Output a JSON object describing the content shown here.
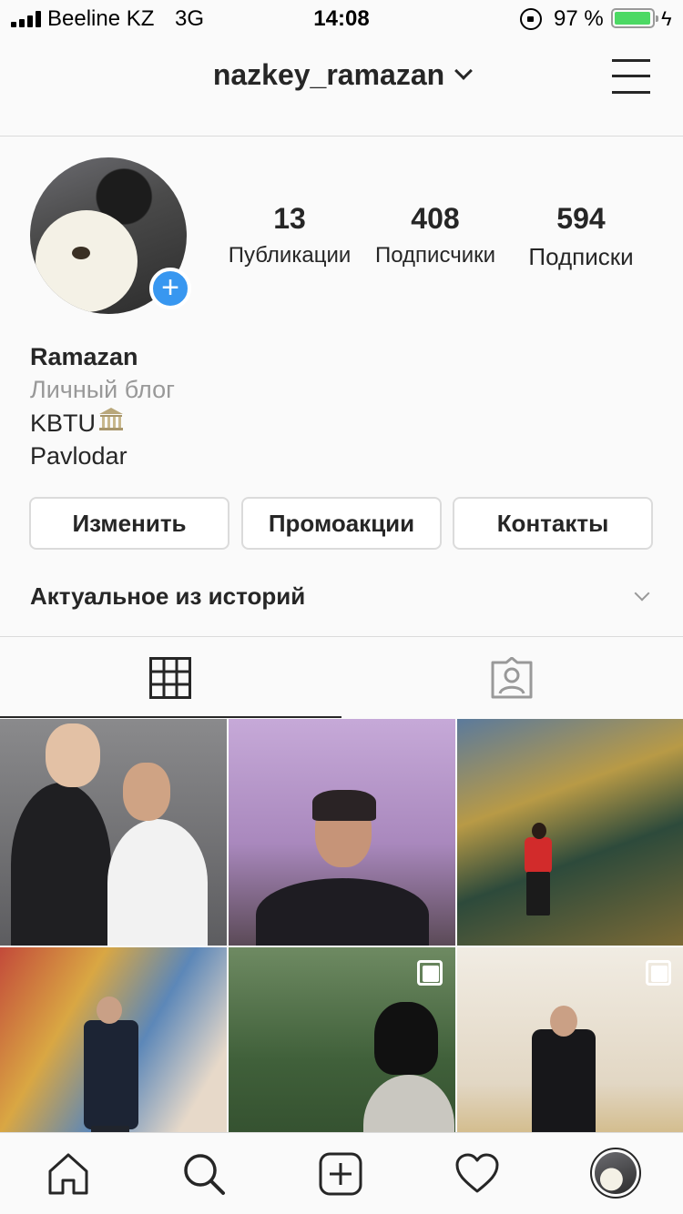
{
  "status_bar": {
    "carrier": "Beeline KZ",
    "network": "3G",
    "time": "14:08",
    "battery_percent": "97 %",
    "battery_level": 0.97
  },
  "header": {
    "username": "nazkey_ramazan"
  },
  "profile": {
    "stats": [
      {
        "value": "13",
        "label": "Публикации"
      },
      {
        "value": "408",
        "label": "Подписчики"
      },
      {
        "value": "594",
        "label": "Подписки"
      }
    ],
    "bio": {
      "name": "Ramazan",
      "category": "Личный блог",
      "line1": "KBTU",
      "line2": "Pavlodar"
    }
  },
  "buttons": {
    "edit": "Изменить",
    "promotions": "Промоакции",
    "contacts": "Контакты"
  },
  "highlights": {
    "title": "Актуальное из историй"
  },
  "tabs": {
    "active": "grid"
  },
  "colors": {
    "accent": "#3897f0",
    "battery": "#4cd964",
    "text": "#262626",
    "muted": "#999999",
    "border": "#dbdbdb"
  },
  "icons": {
    "bottom_bar": [
      "home-icon",
      "search-icon",
      "add-post-icon",
      "heart-icon",
      "profile-avatar"
    ]
  }
}
